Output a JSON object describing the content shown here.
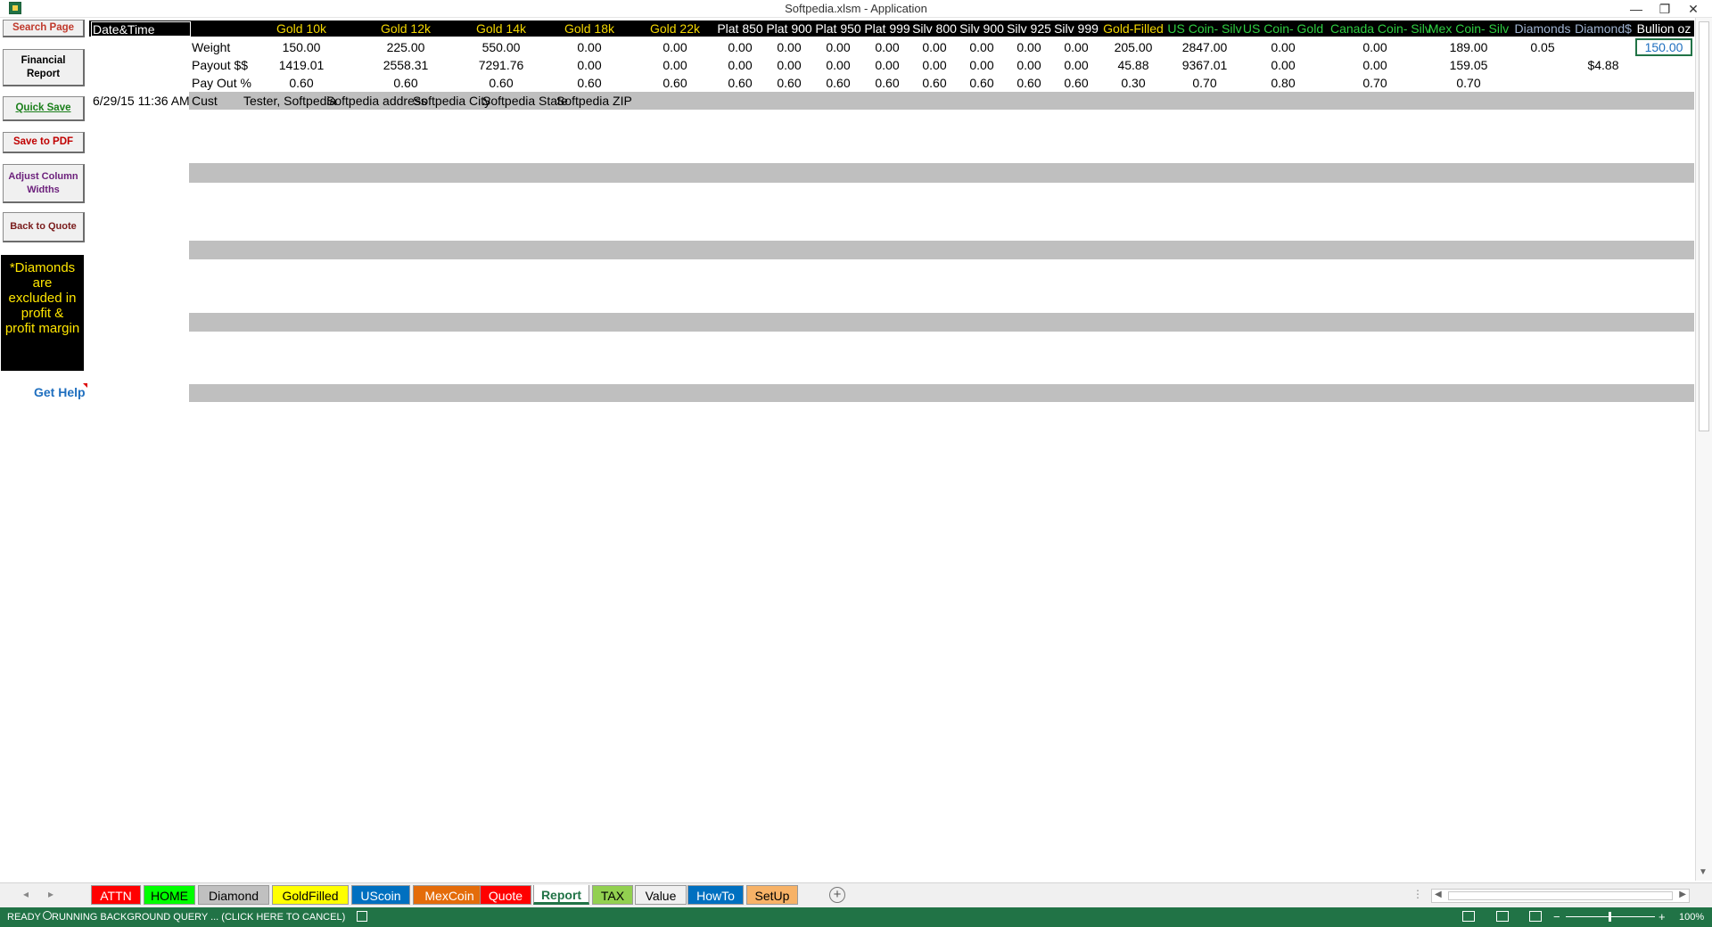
{
  "window": {
    "title": "Softpedia.xlsm - Application",
    "minimize": "—",
    "restore": "❐",
    "close": "✕"
  },
  "left_panel": {
    "search_page": "Search Page",
    "financial_report": "Financial Report",
    "quick_save": "Quick Save",
    "save_pdf": "Save to PDF",
    "adjust_columns": "Adjust Column Widths",
    "back_to_quote": "Back to Quote",
    "note": "*Diamonds are excluded in profit  & profit margin",
    "get_help": "Get Help"
  },
  "header": {
    "datetime_label": "Date&Time",
    "columns": [
      {
        "label": "Gold 10k",
        "color": "#f2d600"
      },
      {
        "label": "Gold 12k",
        "color": "#f2d600"
      },
      {
        "label": "Gold 14k",
        "color": "#f2d600"
      },
      {
        "label": "Gold 18k",
        "color": "#f2d600"
      },
      {
        "label": "Gold 22k",
        "color": "#f2d600"
      },
      {
        "label": "Plat 850",
        "color": "#ffffff"
      },
      {
        "label": "Plat 900",
        "color": "#ffffff"
      },
      {
        "label": "Plat 950",
        "color": "#ffffff"
      },
      {
        "label": "Plat 999",
        "color": "#ffffff"
      },
      {
        "label": "Silv 800",
        "color": "#ffffff"
      },
      {
        "label": "Silv 900",
        "color": "#ffffff"
      },
      {
        "label": "Silv 925",
        "color": "#ffffff"
      },
      {
        "label": "Silv 999",
        "color": "#ffffff"
      },
      {
        "label": "Gold-Filled",
        "color": "#f2d600"
      },
      {
        "label": "US Coin- Silv",
        "color": "#2ecc40"
      },
      {
        "label": "US Coin- Gold",
        "color": "#2ecc40"
      },
      {
        "label": "Canada Coin- Silv",
        "color": "#2ecc40"
      },
      {
        "label": "Mex Coin- Silv",
        "color": "#2ecc40"
      },
      {
        "label": "Diamonds",
        "color": "#9fb3d1"
      },
      {
        "label": "Diamond$",
        "color": "#9fb3d1"
      },
      {
        "label": "Bullion oz",
        "color": "#ffffff"
      }
    ]
  },
  "rows": {
    "weight": {
      "label": "Weight",
      "values": [
        "150.00",
        "225.00",
        "550.00",
        "0.00",
        "0.00",
        "0.00",
        "0.00",
        "0.00",
        "0.00",
        "0.00",
        "0.00",
        "0.00",
        "0.00",
        "205.00",
        "2847.00",
        "0.00",
        "0.00",
        "189.00",
        "0.05",
        "",
        "150.00"
      ]
    },
    "payout": {
      "label": "Payout $$",
      "values": [
        "1419.01",
        "2558.31",
        "7291.76",
        "0.00",
        "0.00",
        "0.00",
        "0.00",
        "0.00",
        "0.00",
        "0.00",
        "0.00",
        "0.00",
        "0.00",
        "45.88",
        "9367.01",
        "0.00",
        "0.00",
        "159.05",
        "",
        "$4.88",
        ""
      ]
    },
    "payout_pct": {
      "label": "Pay Out %",
      "values": [
        "0.60",
        "0.60",
        "0.60",
        "0.60",
        "0.60",
        "0.60",
        "0.60",
        "0.60",
        "0.60",
        "0.60",
        "0.60",
        "0.60",
        "0.60",
        "0.30",
        "0.70",
        "0.80",
        "0.70",
        "0.70",
        "",
        "",
        ""
      ]
    }
  },
  "record": {
    "datetime": "6/29/15 11:36 AM",
    "cust_label": "Cust",
    "name": "Tester, Softpedia",
    "address": "Softpedia address",
    "city": "Softpedia City",
    "state": "Softpedia State",
    "zip": "Softpedia ZIP"
  },
  "tabs": [
    {
      "label": "ATTN",
      "bg": "#ff0000",
      "fg": "#ffffff"
    },
    {
      "label": "HOME",
      "bg": "#00ff00",
      "fg": "#000000"
    },
    {
      "label": "Diamond",
      "bg": "#c0c0c0",
      "fg": "#000000"
    },
    {
      "label": "GoldFilled",
      "bg": "#ffff00",
      "fg": "#000000"
    },
    {
      "label": "UScoin",
      "bg": "#0070c0",
      "fg": "#ffffff"
    },
    {
      "label": "MexCoin",
      "bg": "#e46c0a",
      "fg": "#ffffff"
    },
    {
      "label": "Quote",
      "bg": "#ff0000",
      "fg": "#ffffff"
    },
    {
      "label": "Report",
      "bg": "#ffffff",
      "fg": "#217346"
    },
    {
      "label": "TAX",
      "bg": "#92d050",
      "fg": "#000000"
    },
    {
      "label": "Value",
      "bg": "#f0f0f0",
      "fg": "#000000"
    },
    {
      "label": "HowTo",
      "bg": "#0070c0",
      "fg": "#ffffff"
    },
    {
      "label": "SetUp",
      "bg": "#f7b267",
      "fg": "#000000"
    }
  ],
  "active_tab": "Report",
  "status": {
    "ready": "READY",
    "query": "RUNNING BACKGROUND QUERY ...   (CLICK HERE TO CANCEL)",
    "zoom": "100%"
  }
}
